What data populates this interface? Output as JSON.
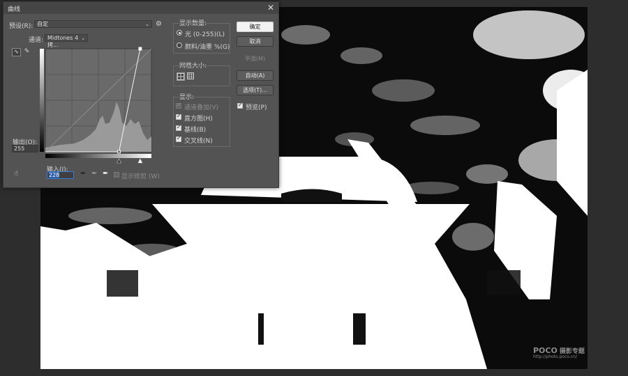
{
  "dialog": {
    "title": "曲线",
    "preset_label": "预设(R):",
    "preset_value": "自定",
    "channel_label": "通道:",
    "channel_value": "Midtones 4 拷...",
    "output_label": "输出(O):",
    "output_value": "255",
    "input_label": "输入(I):",
    "input_value": "228",
    "show_clipping_label": "显示修剪 (W)"
  },
  "buttons": {
    "ok": "确定",
    "cancel": "取消",
    "smooth": "平滑(M)",
    "auto": "自动(A)",
    "options": "选项(T)...",
    "preview": "预览(P)"
  },
  "show_amount": {
    "title": "显示数量:",
    "light": "光 (0-255)(L)",
    "pigment": "颜料/油墨 %(G)",
    "selected": "light"
  },
  "grid_size": {
    "title": "网格大小:"
  },
  "display": {
    "title": "显示:",
    "channel_overlay": "通道叠加(V)",
    "histogram": "直方图(H)",
    "baseline": "基线(B)",
    "intersection": "交叉线(N)",
    "channel_overlay_checked": true,
    "histogram_checked": true,
    "baseline_checked": true,
    "intersection_checked": true,
    "preview_checked": true
  },
  "curve": {
    "points": [
      [
        177,
        0
      ],
      [
        228,
        255
      ]
    ]
  },
  "watermark": {
    "brand": "POCO",
    "sub": "摄影专题",
    "url": "http://photo.poco.cn/"
  },
  "colors": {
    "dialog_bg": "#535353",
    "accent_blue": "#3b7bd4"
  }
}
